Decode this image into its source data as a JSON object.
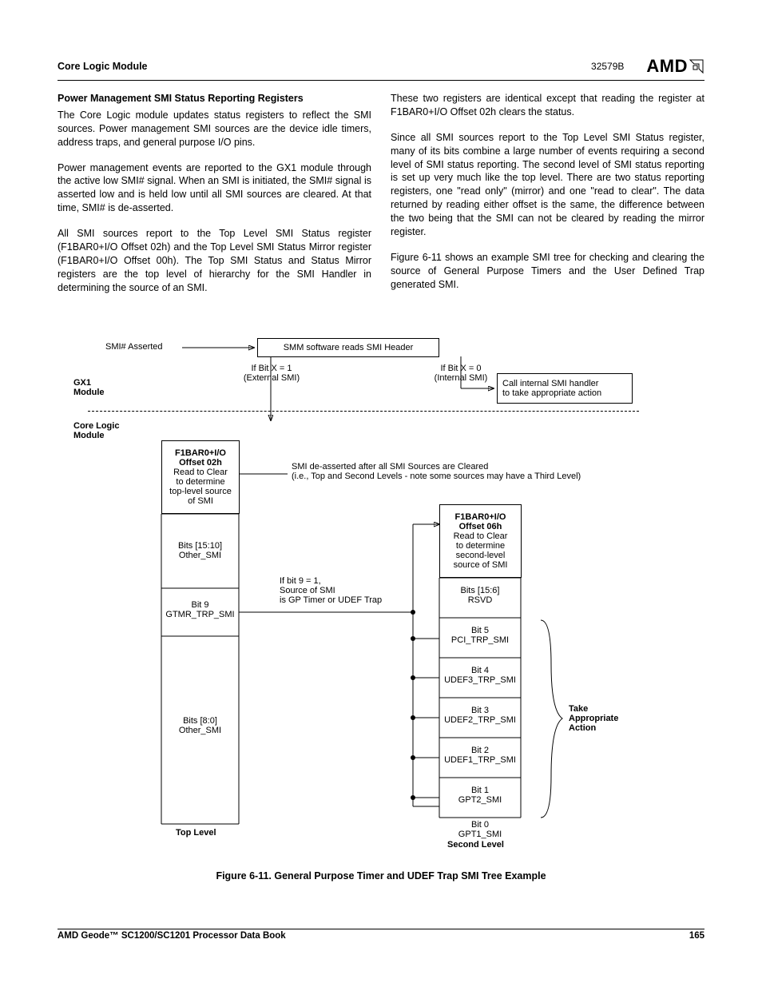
{
  "header": {
    "section": "Core Logic Module",
    "docno": "32579B",
    "logo": "AMD"
  },
  "body": {
    "heading": "Power Management SMI Status Reporting Registers",
    "p1": "The Core Logic module updates status registers to reflect the SMI sources. Power management SMI sources are the device idle timers, address traps, and general purpose I/O pins.",
    "p2": "Power management events are reported to the GX1 module through the active low SMI# signal. When an SMI is initiated, the SMI# signal is asserted low and is held low until all SMI sources are cleared. At that time, SMI# is de-asserted.",
    "p3": "All SMI sources report to the Top Level SMI Status register (F1BAR0+I/O Offset 02h) and the Top Level SMI Status Mirror register (F1BAR0+I/O Offset 00h). The Top SMI Status and Status Mirror registers are the top level of hierarchy for the SMI Handler in determining the source of an SMI.",
    "p4": "These two registers are identical except that reading the register at F1BAR0+I/O Offset 02h clears the status.",
    "p5": "Since all SMI sources report to the Top Level SMI Status register, many of its bits combine a large number of events requiring a second level of SMI status reporting. The second level of SMI status reporting is set up very much like the top level. There are two status reporting registers, one \"read only\" (mirror) and one \"read to clear\". The data returned by reading either offset is the same, the difference between the two being that the SMI can not be cleared by reading the mirror register.",
    "p6": "Figure 6-11 shows an example SMI tree for checking and clearing the source of General Purpose Timers and the User Defined Trap generated SMI."
  },
  "diagram": {
    "smi": "SMI# Asserted",
    "top_big": "SMM software reads SMI Header",
    "bitx1a": "If Bit X = 1",
    "bitx1b": "(External SMI)",
    "bitx0a": "If Bit X = 0",
    "bitx0b": "(Internal SMI)",
    "call1": "Call internal SMI handler",
    "call2": "to take appropriate action",
    "gx1a": "GX1",
    "gx1b": "Module",
    "corea": "Core Logic",
    "coreb": "Module",
    "box02_a": "F1BAR0+I/O",
    "box02_b": "Offset 02h",
    "box02_c": "Read to Clear",
    "box02_d": "to determine",
    "box02_e": "top-level source",
    "box02_f": "of SMI",
    "de1": "SMI de-asserted after all SMI Sources are Cleared",
    "de2": "(i.e., Top and Second Levels - note some sources may have a Third Level)",
    "box06_a": "F1BAR0+I/O",
    "box06_b": "Offset 06h",
    "box06_c": "Read to Clear",
    "box06_d": "to determine",
    "box06_e": "second-level",
    "box06_f": "source of SMI",
    "ifbit9a": "If bit 9 = 1,",
    "ifbit9b": "Source of SMI",
    "ifbit9c": "is GP Timer or UDEF Trap",
    "top_b1a": "Bits [15:10]",
    "top_b1b": "Other_SMI",
    "top_b2a": "Bit 9",
    "top_b2b": "GTMR_TRP_SMI",
    "top_b3a": "Bits [8:0]",
    "top_b3b": "Other_SMI",
    "sec_b0a": "Bits [15:6]",
    "sec_b0b": "RSVD",
    "sec_b5a": "Bit 5",
    "sec_b5b": "PCI_TRP_SMI",
    "sec_b4a": "Bit 4",
    "sec_b4b": "UDEF3_TRP_SMI",
    "sec_b3a": "Bit 3",
    "sec_b3b": "UDEF2_TRP_SMI",
    "sec_b2a": "Bit 2",
    "sec_b2b": "UDEF1_TRP_SMI",
    "sec_b1a": "Bit 1",
    "sec_b1b": "GPT2_SMI",
    "sec_b0xa": "Bit 0",
    "sec_b0xb": "GPT1_SMI",
    "action_a": "Take",
    "action_b": "Appropriate",
    "action_c": "Action",
    "lvl_top": "Top Level",
    "lvl_sec": "Second Level",
    "caption": "Figure 6-11.  General Purpose Timer and UDEF Trap SMI Tree Example"
  },
  "footer": {
    "title": "AMD Geode™ SC1200/SC1201 Processor Data Book",
    "page": "165"
  }
}
